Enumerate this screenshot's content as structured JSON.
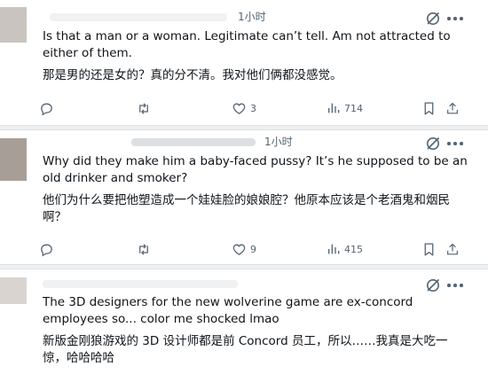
{
  "posts": [
    {
      "time": "1小时",
      "text_en": "Is that a man or a woman. Legitimate can’t tell. Am not attracted to either of them.",
      "text_zh": "那是男的还是女的？真的分不清。我对他们俩都没感觉。",
      "reply_count": "",
      "retweet_count": "",
      "like_count": "3",
      "view_count": "714"
    },
    {
      "time": "1小时",
      "text_en": "Why did they make him a baby-faced pussy? It’s he supposed to be an old drinker and smoker?",
      "text_zh": "他们为什么要把他塑造成一个娃娃脸的娘娘腔？他原本应该是个老酒鬼和烟民啊？",
      "reply_count": "",
      "retweet_count": "",
      "like_count": "9",
      "view_count": "415"
    },
    {
      "time": "",
      "text_en": "The 3D designers for the new wolverine game are ex-concord employees so... color me shocked lmao",
      "text_zh": "新版金刚狼游戏的 3D 设计师都是前 Concord 员工，所以……我真是大吃一惊，哈哈哈哈"
    }
  ],
  "icons": {
    "reply": "reply-icon",
    "retweet": "retweet-icon",
    "like": "heart-icon",
    "views": "views-icon",
    "bookmark": "bookmark-icon",
    "share": "share-icon",
    "grok": "grok-icon",
    "more": "more-icon"
  },
  "colors": {
    "text": "#0f1419",
    "secondary": "#536471",
    "divider": "#eef0f1"
  }
}
